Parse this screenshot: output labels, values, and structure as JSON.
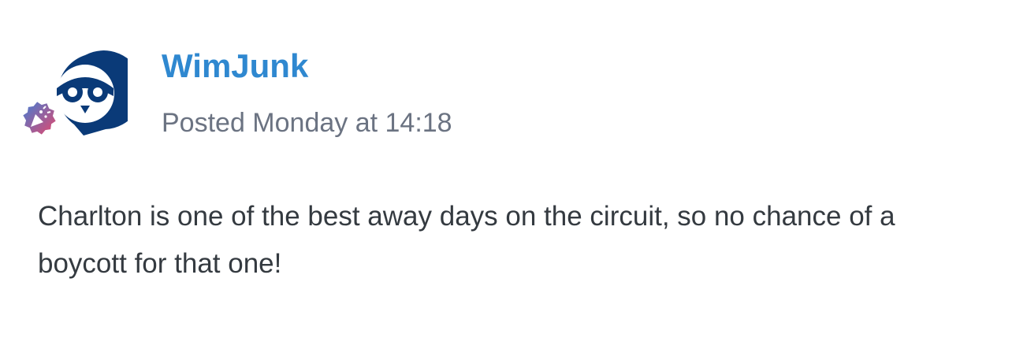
{
  "post": {
    "author": {
      "name": "WimJunk",
      "avatar_icon": "owl-logo-icon",
      "badge_icon": "party-popper-icon",
      "brand_color": "#0a3a78",
      "badge_gradient": [
        "#3f7fd6",
        "#e8466a"
      ]
    },
    "meta": {
      "posted_text": "Posted Monday at 14:18"
    },
    "body": {
      "text": "Charlton is one of the best away days on the circuit, so no chance of a boycott for that one!"
    }
  },
  "colors": {
    "author_link": "#2f88d0",
    "meta_text": "#6b7382",
    "body_text": "#343a40"
  }
}
